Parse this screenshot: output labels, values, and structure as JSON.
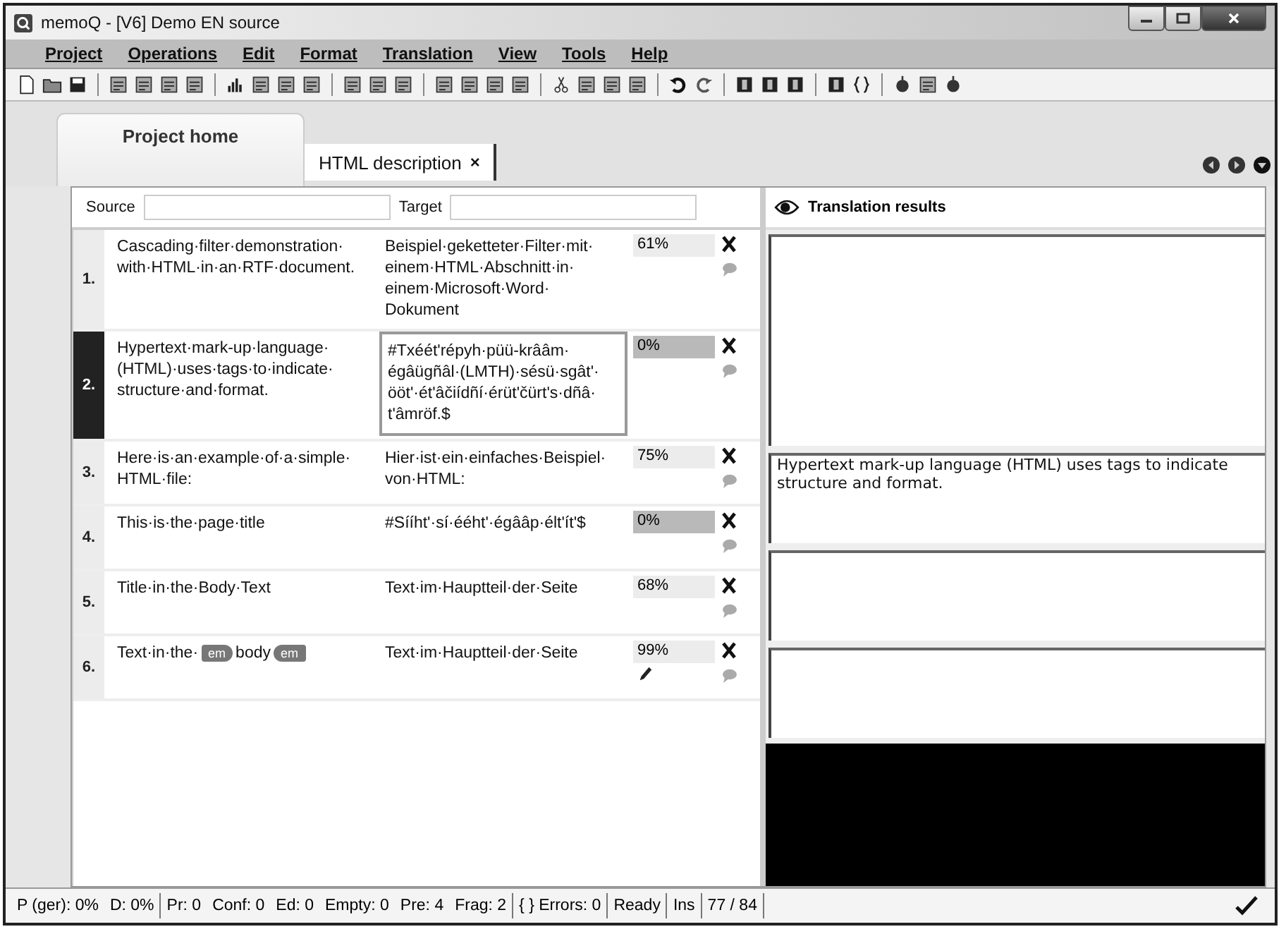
{
  "window": {
    "title": "memoQ - [V6] Demo EN source"
  },
  "menu": [
    "Project",
    "Operations",
    "Edit",
    "Format",
    "Translation",
    "View",
    "Tools",
    "Help"
  ],
  "tabs": [
    {
      "label": "Project home",
      "selected": false,
      "kind": "home"
    },
    {
      "label": "HTML description",
      "close": "×",
      "selected": true,
      "kind": "document"
    }
  ],
  "grid": {
    "source_label": "Source",
    "target_label": "Target",
    "rows": [
      {
        "number": "1.",
        "selected": false,
        "source": [
          {
            "kind": "text",
            "text": "Cascading·filter·demonstration·with·HTML·in·an·RTF·document."
          }
        ],
        "target": "Beispiel·geketteter·Filter·mit·einem·HTML·Abschnitt·in·einem·Microsoft·Word·Dokument",
        "match": "61%",
        "kind": "fuzzy",
        "edited": false
      },
      {
        "number": "2.",
        "selected": true,
        "source": [
          {
            "kind": "text",
            "text": "Hypertext·mark-up·language·(HTML)·uses·tags·to·indicate·structure·and·format."
          }
        ],
        "target": "#Txéét'répyh·püü-krââm·égâügñâl·(LMTH)·sésü·sgât'·ööt'·ét'âčiídñí·érüt'čürt's·dñâ·t'âmröf.$",
        "match": "0%",
        "kind": "new",
        "edited": false
      },
      {
        "number": "3.",
        "selected": false,
        "source": [
          {
            "kind": "text",
            "text": "Here·is·an·example·of·a·simple·HTML·file:"
          }
        ],
        "target": "Hier·ist·ein·einfaches·Beispiel·von·HTML:",
        "match": "75%",
        "kind": "fuzzy",
        "edited": false
      },
      {
        "number": "4.",
        "selected": false,
        "source": [
          {
            "kind": "text",
            "text": "This·is·the·page·title"
          }
        ],
        "target": "#Sííht'·sí·ééht'·égââp·élt'ít'$",
        "match": "0%",
        "kind": "new",
        "edited": false
      },
      {
        "number": "5.",
        "selected": false,
        "source": [
          {
            "kind": "text",
            "text": "Title·in·the·Body·Text"
          }
        ],
        "target": "Text·im·Hauptteil·der·Seite",
        "match": "68%",
        "kind": "fuzzy",
        "edited": false
      },
      {
        "number": "6.",
        "selected": false,
        "source": [
          {
            "kind": "text",
            "text": "Text·in·the·"
          },
          {
            "kind": "open-tag",
            "text": "em"
          },
          {
            "kind": "text",
            "text": "body"
          },
          {
            "kind": "close-tag",
            "text": "em"
          }
        ],
        "target": "Text·im·Hauptteil·der·Seite",
        "match": "99%",
        "kind": "fuzzy",
        "edited": true
      }
    ]
  },
  "results": {
    "title": "Translation results",
    "text": "Hypertext mark-up language (HTML) uses tags to indicate structure and format."
  },
  "status_bar": [
    [
      "P (ger): 0%",
      "D: 0%"
    ],
    [
      "Pr: 0",
      "Conf: 0",
      "Ed: 0",
      "Empty: 0",
      "Pre: 4",
      "Frag: 2"
    ],
    [
      "{ } Errors: 0"
    ],
    [
      "Ready"
    ],
    [
      "Ins"
    ],
    [
      "77 / 84"
    ]
  ]
}
